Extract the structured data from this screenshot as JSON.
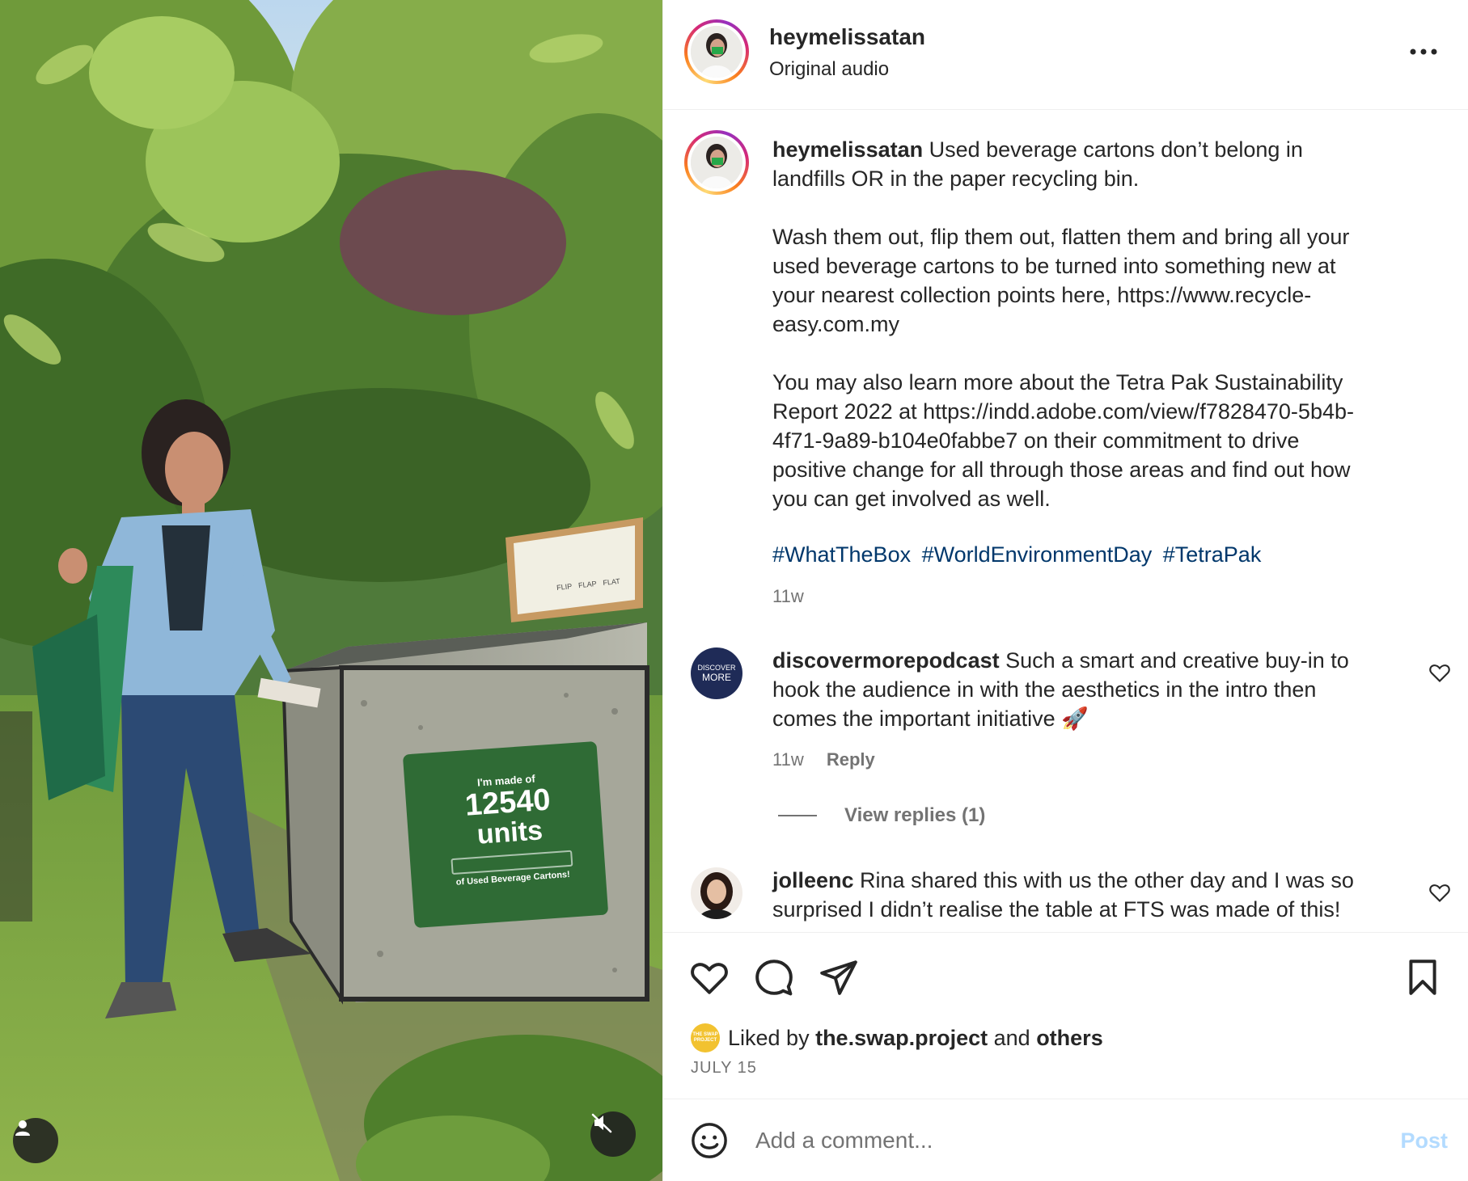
{
  "header": {
    "username": "heymelissatan",
    "subtitle": "Original audio"
  },
  "media": {
    "sign_line1": "I'm made of",
    "sign_number": "12540",
    "sign_line2": "units",
    "sign_line3": "of Used Beverage Cartons!",
    "poster_words": [
      "FLIP",
      "FLAP",
      "FLAT"
    ]
  },
  "caption": {
    "username": "heymelissatan",
    "text": " Used beverage cartons don’t belong in\nlandfills OR in the paper recycling bin.\n\nWash them out, flip them out, flatten them and bring all your\nused beverage cartons to be turned into something new at\nyour nearest collection points here, https://www.recycle-\neasy.com.my\n\nYou may also learn more about the Tetra Pak Sustainability\nReport 2022 at https://indd.adobe.com/view/f7828470-5b4b-\n4f71-9a89-b104e0fabbe7 on their commitment to drive\npositive change for all through those areas and find out how\nyou can get involved as well.",
    "hashtags": [
      "#WhatTheBox",
      "#WorldEnvironmentDay",
      "#TetraPak"
    ],
    "time": "11w"
  },
  "comments": [
    {
      "username": "discovermorepodcast",
      "text": " Such a smart and creative buy-in to\nhook the audience in with the aesthetics in the intro then\ncomes the important initiative 🚀",
      "time": "11w",
      "reply_label": "Reply",
      "view_replies": "View replies (1)",
      "avatar_line1": "DISCOVER",
      "avatar_line2": "MORE"
    },
    {
      "username": "jolleenc",
      "text": " Rina shared this with us the other day and I was so\nsurprised I didn’t realise the table at FTS was made of this!"
    }
  ],
  "likes": {
    "prefix": "Liked by ",
    "user": "the.swap.project",
    "middle": " and ",
    "others": "others",
    "mini_avatar_text": "THE SWAP PROJECT"
  },
  "date": "JULY 15",
  "add_comment": {
    "placeholder": "Add a comment...",
    "post_label": "Post"
  },
  "colors": {
    "hashtag": "#00376b",
    "post_disabled": "#b3dbff",
    "sign_green": "#2f6b35"
  }
}
